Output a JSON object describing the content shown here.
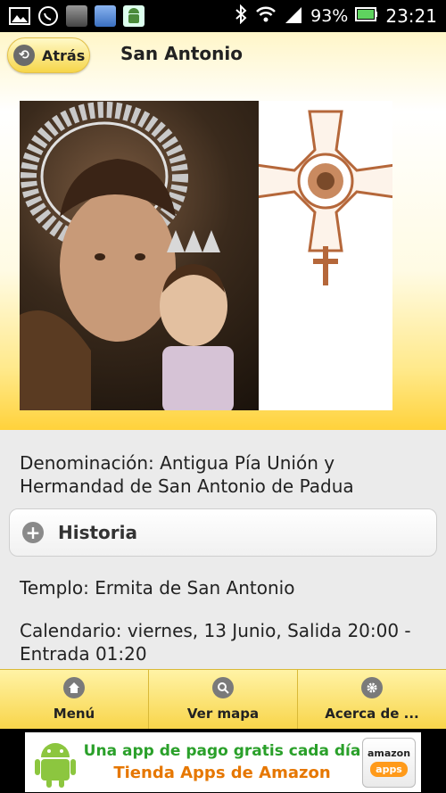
{
  "status_bar": {
    "battery": "93%",
    "time": "23:21",
    "icons": [
      "gallery-icon",
      "whatsapp-icon",
      "app-icon",
      "app-icon-2",
      "android-icon",
      "bluetooth-icon",
      "wifi-icon",
      "signal-icon",
      "battery-icon"
    ]
  },
  "header": {
    "back_label": "Atrás",
    "title": "San Antonio"
  },
  "content": {
    "denominacion_line1": "Denominación: Antigua Pía Unión y",
    "denominacion_line2": "Hermandad de San Antonio de Padua",
    "historia_label": "Historia",
    "templo": "Templo: Ermita de San Antonio",
    "calendario_line1": "Calendario: viernes, 13 Junio, Salida 20:00 -",
    "calendario_line2": "Entrada 01:20"
  },
  "nav": {
    "items": [
      {
        "label": "Menú",
        "icon": "home-icon"
      },
      {
        "label": "Ver mapa",
        "icon": "search-icon"
      },
      {
        "label": "Acerca de ...",
        "icon": "gear-icon"
      }
    ]
  },
  "ad": {
    "line1": "Una app de pago gratis cada día",
    "line2": "Tienda Apps de Amazon",
    "logo_top": "amazon",
    "logo_pill": "apps"
  },
  "colors": {
    "accent_yellow": "#f8d54a",
    "ad_green": "#2aa02a",
    "ad_orange": "#e67700"
  }
}
